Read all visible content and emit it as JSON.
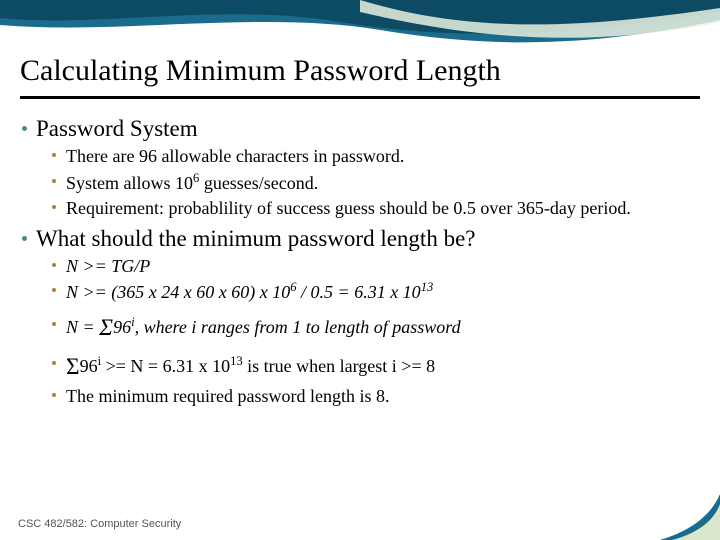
{
  "title": "Calculating Minimum Password Length",
  "footer": "CSC 482/582: Computer Security",
  "section1": {
    "heading": "Password System",
    "b1": "There are 96 allowable characters in password.",
    "b2_pre": "System allows 10",
    "b2_sup": "6",
    "b2_post": " guesses/second.",
    "b3": "Requirement: probablility of success guess should be 0.5 over 365-day period."
  },
  "section2": {
    "heading": "What should the minimum password length be?",
    "b1": "N >= TG/P",
    "b2_pre": "N >= (365 x 24 x 60 x 60) x 10",
    "b2_sup": "6",
    "b2_mid": " / 0.5 = 6.31 x 10",
    "b2_sup2": "13",
    "b3_a": "N = ",
    "b3_b": "96",
    "b3_c": "i",
    "b3_d": ", where i ranges from 1 to length of password",
    "b4_a": "96",
    "b4_b": "i",
    "b4_c": " >= N = 6.31 x 10",
    "b4_sup": "13",
    "b4_d": " is true when largest i >= 8",
    "b5": "The minimum required password length is 8."
  }
}
